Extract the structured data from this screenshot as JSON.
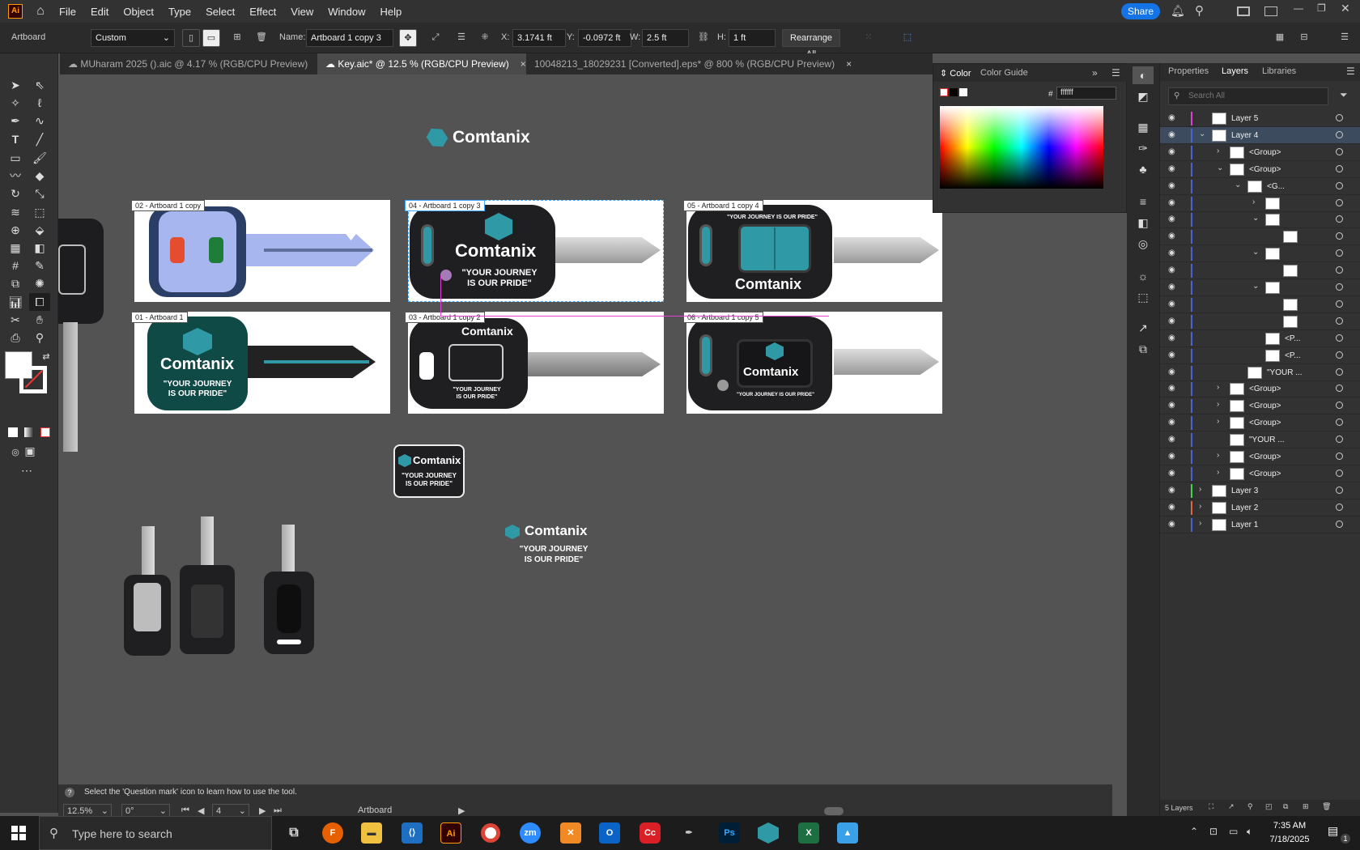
{
  "menubar": {
    "app_badge": "Ai",
    "items": [
      "File",
      "Edit",
      "Object",
      "Type",
      "Select",
      "Effect",
      "View",
      "Window",
      "Help"
    ],
    "share_label": "Share"
  },
  "control": {
    "tool_label": "Artboard",
    "preset": "Custom",
    "name_label": "Name:",
    "name_value": "Artboard 1 copy 3",
    "x_label": "X:",
    "x_value": "3.1741 ft",
    "y_label": "Y:",
    "y_value": "-0.0972 ft",
    "w_label": "W:",
    "w_value": "2.5 ft",
    "h_label": "H:",
    "h_value": "1 ft",
    "rearrange_label": "Rearrange All"
  },
  "tabs": [
    {
      "label": "MUharam 2025 ().aic @ 4.17 % (RGB/CPU Preview)",
      "close": "×"
    },
    {
      "label": "Key.aic* @ 12.5 % (RGB/CPU Preview)",
      "close": "×"
    },
    {
      "label": "10048213_18029231 [Converted].eps* @ 800 % (RGB/CPU Preview)",
      "close": "×"
    }
  ],
  "canvas": {
    "brand": "Comtanix",
    "tagline_line1": "\"YOUR JOURNEY",
    "tagline_line2": "IS OUR PRIDE\"",
    "tagline_single": "\"YOUR JOURNEY IS OUR PRIDE\"",
    "artboards": [
      {
        "label": "02 - Artboard 1 copy"
      },
      {
        "label": "04 - Artboard 1 copy 3"
      },
      {
        "label": "05 - Artboard 1 copy 4"
      },
      {
        "label": "01 - Artboard 1"
      },
      {
        "label": "03 - Artboard 1 copy 2"
      },
      {
        "label": "06 - Artboard 1 copy 5"
      }
    ]
  },
  "color_panel": {
    "tab_color": "Color",
    "tab_guide": "Color Guide",
    "hash": "#",
    "hex_value": "ffffff"
  },
  "right_panel": {
    "tabs": [
      "Properties",
      "Layers",
      "Libraries"
    ],
    "search_placeholder": "Search All",
    "layers": [
      {
        "name": "Layer 5"
      },
      {
        "name": "Layer 4"
      },
      {
        "name": "<Group>"
      },
      {
        "name": "<Group>"
      },
      {
        "name": "<G..."
      },
      {
        "name": ""
      },
      {
        "name": ""
      },
      {
        "name": ""
      },
      {
        "name": ""
      },
      {
        "name": ""
      },
      {
        "name": ""
      },
      {
        "name": ""
      },
      {
        "name": ""
      },
      {
        "name": "<P..."
      },
      {
        "name": "<P..."
      },
      {
        "name": "\"YOUR ..."
      },
      {
        "name": "<Group>"
      },
      {
        "name": "<Group>"
      },
      {
        "name": "<Group>"
      },
      {
        "name": "\"YOUR ..."
      },
      {
        "name": "<Group>"
      },
      {
        "name": "<Group>"
      },
      {
        "name": "Layer 3"
      },
      {
        "name": "Layer 2"
      },
      {
        "name": "Layer 1"
      }
    ],
    "footer_count": "5 Layers"
  },
  "status": {
    "hint": "Select the 'Question mark' icon to learn how to use the tool.",
    "zoom": "12.5%",
    "rotation": "0°",
    "artboard_num": "4",
    "tool_name": "Artboard"
  },
  "taskbar": {
    "search_placeholder": "Type here to search",
    "time": "7:35 AM",
    "date": "7/18/2025",
    "notif": "1"
  },
  "colors": {
    "teal": "#2f9aa6",
    "navy": "#2b3e66",
    "dark_green": "#0f4a47",
    "key_dark": "#1f1f22",
    "selection": "#3fa7ff",
    "guide": "#e23fd6"
  }
}
